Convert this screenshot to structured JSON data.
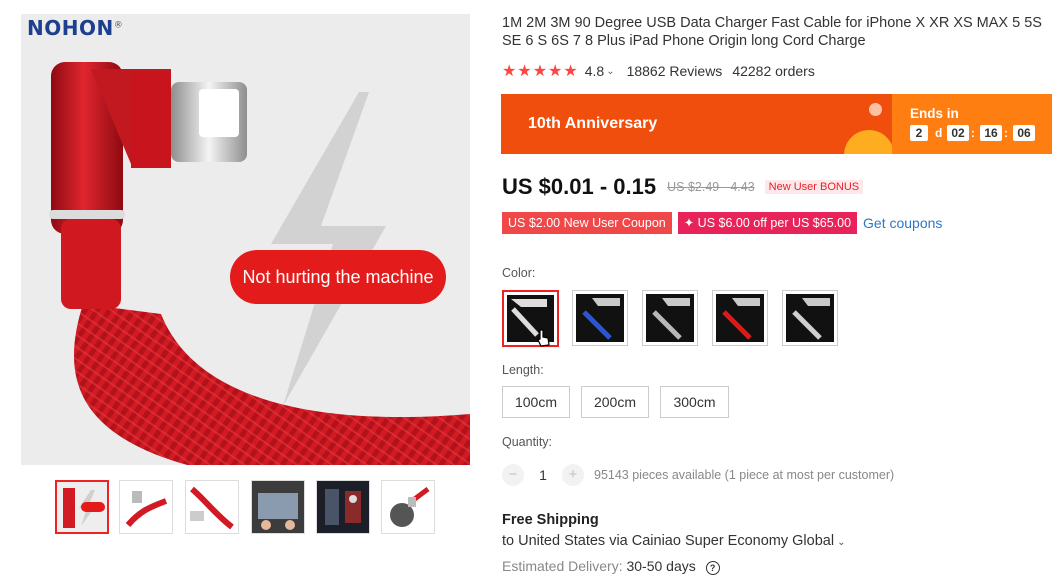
{
  "product": {
    "title": "1M 2M 3M 90 Degree USB Data Charger Fast Cable for iPhone X XR XS MAX 5 5S SE 6 S 6S 7 8 Plus iPad Phone Origin long Cord Charge",
    "rating": "4.8",
    "rating_stars": 5,
    "reviews": "18862 Reviews",
    "orders": "42282 orders"
  },
  "gallery": {
    "brand": "NOHON",
    "brand_mark": "®",
    "callout": "Not hurting the machine",
    "thumbnails": [
      "thumb-1",
      "thumb-2",
      "thumb-3",
      "thumb-4",
      "thumb-5",
      "thumb-6"
    ],
    "selected_thumbnail": 0
  },
  "promo": {
    "title": "10th Anniversary",
    "ends_label": "Ends in",
    "days": "2",
    "days_unit": "d",
    "hours": "02",
    "minutes": "16",
    "seconds": "06",
    "separator": ":"
  },
  "price": {
    "current": "US $0.01 - 0.15",
    "original": "US $2.49 - 4.43",
    "badge": "New User BONUS"
  },
  "coupons": {
    "coupon_1": "US $2.00 New User Coupon",
    "coupon_2": "✦ US $6.00 off per US $65.00",
    "link": "Get coupons"
  },
  "color": {
    "label": "Color:",
    "selected_index": 0,
    "options": [
      "white",
      "blue",
      "silver",
      "red",
      "grey"
    ],
    "accent_colors": [
      "#dddddd",
      "#2a55d8",
      "#b8b8b8",
      "#e01818",
      "#cfcfcf"
    ]
  },
  "length": {
    "label": "Length:",
    "options": [
      "100cm",
      "200cm",
      "300cm"
    ]
  },
  "quantity": {
    "label": "Quantity:",
    "minus": "−",
    "plus": "+",
    "value": "1",
    "available": "95143 pieces available (1 piece at most per customer)"
  },
  "shipping": {
    "title": "Free Shipping",
    "route": "to United States via Cainiao Super Economy Global",
    "delivery_label": "Estimated Delivery:",
    "delivery_days": "30-50 days",
    "help_glyph": "?"
  },
  "colors": {
    "accent_red": "#e22222",
    "promo_orange": "#f04e0c",
    "countdown_orange": "#ff7e12",
    "link_blue": "#2e76c8"
  }
}
